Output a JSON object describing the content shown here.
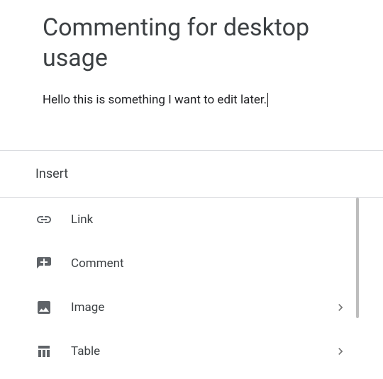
{
  "document": {
    "title": "Commenting for desktop usage",
    "body_text": "Hello this is something I want to edit later."
  },
  "insert_sheet": {
    "heading": "Insert",
    "items": [
      {
        "icon": "link-icon",
        "label": "Link",
        "has_submenu": false
      },
      {
        "icon": "comment-icon",
        "label": "Comment",
        "has_submenu": false
      },
      {
        "icon": "image-icon",
        "label": "Image",
        "has_submenu": true
      },
      {
        "icon": "table-icon",
        "label": "Table",
        "has_submenu": true
      }
    ]
  }
}
